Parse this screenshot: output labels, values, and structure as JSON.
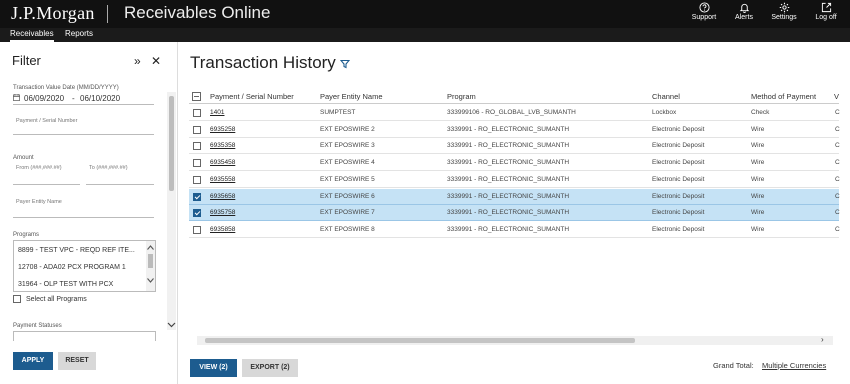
{
  "header": {
    "brand": "J.P.Morgan",
    "app_title": "Receivables Online",
    "tools": [
      {
        "label": "Support",
        "icon": "help-circle-icon"
      },
      {
        "label": "Alerts",
        "icon": "bell-icon"
      },
      {
        "label": "Settings",
        "icon": "gear-icon"
      },
      {
        "label": "Log off",
        "icon": "logout-icon"
      }
    ]
  },
  "nav": {
    "tabs": [
      {
        "label": "Receivables",
        "active": true
      },
      {
        "label": "Reports",
        "active": false
      }
    ]
  },
  "filter": {
    "title": "Filter",
    "date_label": "Transaction Value Date (MM/DD/YYYY)",
    "date_from": "06/09/2020",
    "date_sep": "-",
    "date_to": "06/10/2020",
    "payment_serial_placeholder": "Payment / Serial Number",
    "amount_label": "Amount",
    "amount_from_placeholder": "From (###,###.##)",
    "amount_to_placeholder": "To (###,###.##)",
    "payer_entity_placeholder": "Payer Entity Name",
    "programs_label": "Programs",
    "programs": [
      "8899 - TEST VPC - REQD REF ITE...",
      "12708 - ADA02 PCX PROGRAM 1",
      "31964 - OLP TEST WITH PCX"
    ],
    "select_all_label": "Select all Programs",
    "payment_statuses_label": "Payment Statuses",
    "apply_label": "APPLY",
    "reset_label": "RESET"
  },
  "main": {
    "title": "Transaction History",
    "columns": [
      "Payment / Serial Number",
      "Payer Entity Name",
      "Program",
      "Channel",
      "Method of Payment",
      "V"
    ],
    "rows": [
      {
        "serial": "1401",
        "payer": "SUMPTEST",
        "program": "333999106 - RO_GLOBAL_LVB_SUMANTH",
        "channel": "Lockbox",
        "method": "Check",
        "v": "C",
        "selected": false
      },
      {
        "serial": "6935258",
        "payer": "EXT EPOSWIRE 2",
        "program": "3339991 - RO_ELECTRONIC_SUMANTH",
        "channel": "Electronic Deposit",
        "method": "Wire",
        "v": "C",
        "selected": false
      },
      {
        "serial": "6935358",
        "payer": "EXT EPOSWIRE 3",
        "program": "3339991 - RO_ELECTRONIC_SUMANTH",
        "channel": "Electronic Deposit",
        "method": "Wire",
        "v": "C",
        "selected": false
      },
      {
        "serial": "6935458",
        "payer": "EXT EPOSWIRE 4",
        "program": "3339991 - RO_ELECTRONIC_SUMANTH",
        "channel": "Electronic Deposit",
        "method": "Wire",
        "v": "C",
        "selected": false
      },
      {
        "serial": "6935558",
        "payer": "EXT EPOSWIRE 5",
        "program": "3339991 - RO_ELECTRONIC_SUMANTH",
        "channel": "Electronic Deposit",
        "method": "Wire",
        "v": "C",
        "selected": false
      },
      {
        "serial": "6935658",
        "payer": "EXT EPOSWIRE 6",
        "program": "3339991 - RO_ELECTRONIC_SUMANTH",
        "channel": "Electronic Deposit",
        "method": "Wire",
        "v": "C",
        "selected": true
      },
      {
        "serial": "6935758",
        "payer": "EXT EPOSWIRE 7",
        "program": "3339991 - RO_ELECTRONIC_SUMANTH",
        "channel": "Electronic Deposit",
        "method": "Wire",
        "v": "C",
        "selected": true
      },
      {
        "serial": "6935858",
        "payer": "EXT EPOSWIRE 8",
        "program": "3339991 - RO_ELECTRONIC_SUMANTH",
        "channel": "Electronic Deposit",
        "method": "Wire",
        "v": "C",
        "selected": false
      }
    ],
    "view_label": "VIEW (2)",
    "export_label": "EXPORT (2)",
    "grand_total_label": "Grand Total:",
    "grand_total_value": "Multiple Currencies"
  },
  "colors": {
    "accent": "#1d5c8f",
    "selected_row": "#c5e2f5",
    "topbar": "#111111"
  }
}
